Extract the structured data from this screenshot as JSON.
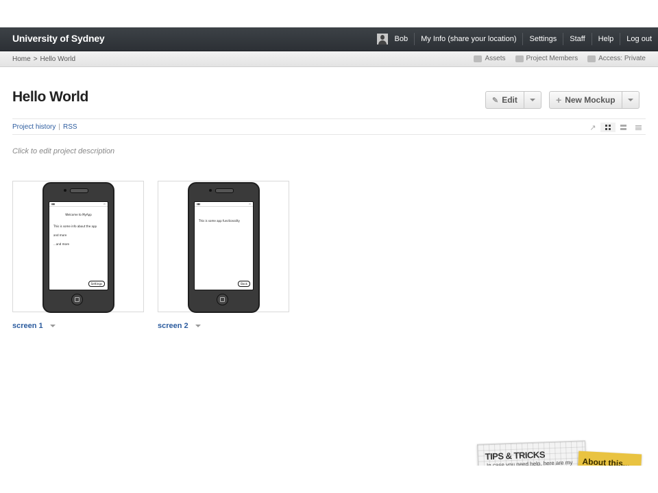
{
  "topbar": {
    "brand": "University of Sydney",
    "user": "Bob",
    "my_info": "My Info (share your location)",
    "settings": "Settings",
    "staff": "Staff",
    "help": "Help",
    "logout": "Log out"
  },
  "breadcrumb": {
    "home": "Home",
    "separator": ">",
    "current": "Hello World",
    "assets": "Assets",
    "members": "Project Members",
    "access": "Access: Private"
  },
  "page": {
    "title": "Hello World",
    "edit_label": "Edit",
    "new_mockup_label": "New Mockup",
    "history_link": "Project history",
    "link_separator": "|",
    "rss_link": "RSS",
    "description_placeholder": "Click to edit project description"
  },
  "mockups": [
    {
      "label": "screen 1",
      "screen_title": "Welcome to MyApp",
      "lines": [
        "This is some info about the app",
        "and more",
        "...and more"
      ],
      "button": "Settings"
    },
    {
      "label": "screen 2",
      "screen_title": "",
      "lines": [
        "This is some app functionality"
      ],
      "button": "Back"
    }
  ],
  "tips": {
    "title": "TIPS & TRICKS",
    "subtitle": "In case you need help, here are my",
    "sticky": "About this..."
  }
}
